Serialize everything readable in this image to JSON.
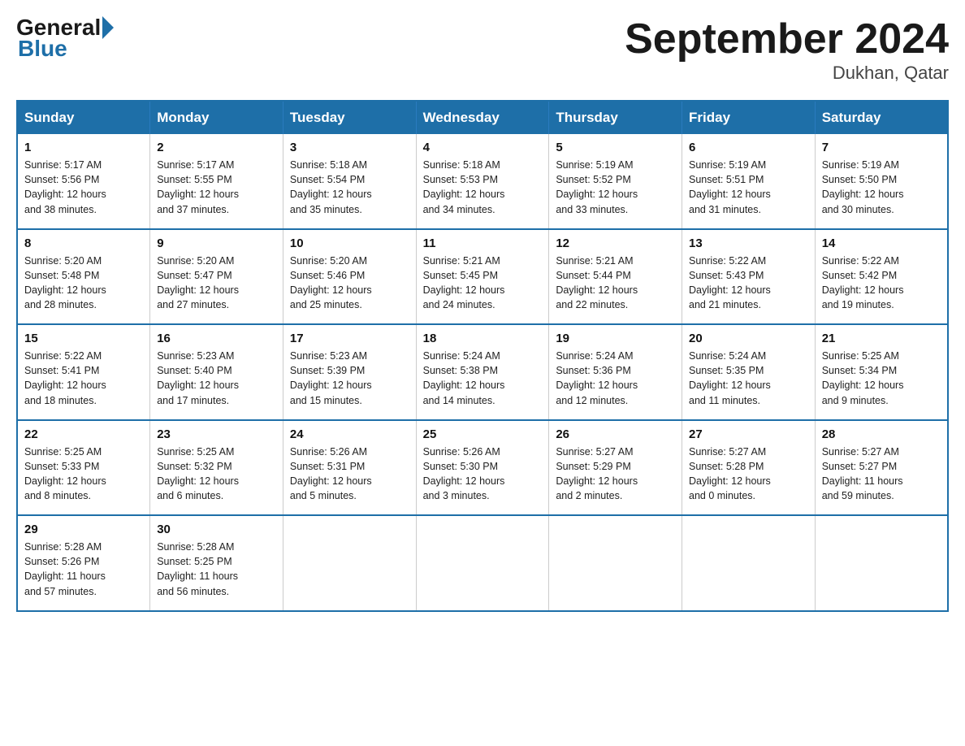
{
  "logo": {
    "general": "General",
    "blue": "Blue"
  },
  "title": "September 2024",
  "subtitle": "Dukhan, Qatar",
  "days_of_week": [
    "Sunday",
    "Monday",
    "Tuesday",
    "Wednesday",
    "Thursday",
    "Friday",
    "Saturday"
  ],
  "weeks": [
    [
      {
        "day": "1",
        "sunrise": "5:17 AM",
        "sunset": "5:56 PM",
        "daylight": "12 hours and 38 minutes."
      },
      {
        "day": "2",
        "sunrise": "5:17 AM",
        "sunset": "5:55 PM",
        "daylight": "12 hours and 37 minutes."
      },
      {
        "day": "3",
        "sunrise": "5:18 AM",
        "sunset": "5:54 PM",
        "daylight": "12 hours and 35 minutes."
      },
      {
        "day": "4",
        "sunrise": "5:18 AM",
        "sunset": "5:53 PM",
        "daylight": "12 hours and 34 minutes."
      },
      {
        "day": "5",
        "sunrise": "5:19 AM",
        "sunset": "5:52 PM",
        "daylight": "12 hours and 33 minutes."
      },
      {
        "day": "6",
        "sunrise": "5:19 AM",
        "sunset": "5:51 PM",
        "daylight": "12 hours and 31 minutes."
      },
      {
        "day": "7",
        "sunrise": "5:19 AM",
        "sunset": "5:50 PM",
        "daylight": "12 hours and 30 minutes."
      }
    ],
    [
      {
        "day": "8",
        "sunrise": "5:20 AM",
        "sunset": "5:48 PM",
        "daylight": "12 hours and 28 minutes."
      },
      {
        "day": "9",
        "sunrise": "5:20 AM",
        "sunset": "5:47 PM",
        "daylight": "12 hours and 27 minutes."
      },
      {
        "day": "10",
        "sunrise": "5:20 AM",
        "sunset": "5:46 PM",
        "daylight": "12 hours and 25 minutes."
      },
      {
        "day": "11",
        "sunrise": "5:21 AM",
        "sunset": "5:45 PM",
        "daylight": "12 hours and 24 minutes."
      },
      {
        "day": "12",
        "sunrise": "5:21 AM",
        "sunset": "5:44 PM",
        "daylight": "12 hours and 22 minutes."
      },
      {
        "day": "13",
        "sunrise": "5:22 AM",
        "sunset": "5:43 PM",
        "daylight": "12 hours and 21 minutes."
      },
      {
        "day": "14",
        "sunrise": "5:22 AM",
        "sunset": "5:42 PM",
        "daylight": "12 hours and 19 minutes."
      }
    ],
    [
      {
        "day": "15",
        "sunrise": "5:22 AM",
        "sunset": "5:41 PM",
        "daylight": "12 hours and 18 minutes."
      },
      {
        "day": "16",
        "sunrise": "5:23 AM",
        "sunset": "5:40 PM",
        "daylight": "12 hours and 17 minutes."
      },
      {
        "day": "17",
        "sunrise": "5:23 AM",
        "sunset": "5:39 PM",
        "daylight": "12 hours and 15 minutes."
      },
      {
        "day": "18",
        "sunrise": "5:24 AM",
        "sunset": "5:38 PM",
        "daylight": "12 hours and 14 minutes."
      },
      {
        "day": "19",
        "sunrise": "5:24 AM",
        "sunset": "5:36 PM",
        "daylight": "12 hours and 12 minutes."
      },
      {
        "day": "20",
        "sunrise": "5:24 AM",
        "sunset": "5:35 PM",
        "daylight": "12 hours and 11 minutes."
      },
      {
        "day": "21",
        "sunrise": "5:25 AM",
        "sunset": "5:34 PM",
        "daylight": "12 hours and 9 minutes."
      }
    ],
    [
      {
        "day": "22",
        "sunrise": "5:25 AM",
        "sunset": "5:33 PM",
        "daylight": "12 hours and 8 minutes."
      },
      {
        "day": "23",
        "sunrise": "5:25 AM",
        "sunset": "5:32 PM",
        "daylight": "12 hours and 6 minutes."
      },
      {
        "day": "24",
        "sunrise": "5:26 AM",
        "sunset": "5:31 PM",
        "daylight": "12 hours and 5 minutes."
      },
      {
        "day": "25",
        "sunrise": "5:26 AM",
        "sunset": "5:30 PM",
        "daylight": "12 hours and 3 minutes."
      },
      {
        "day": "26",
        "sunrise": "5:27 AM",
        "sunset": "5:29 PM",
        "daylight": "12 hours and 2 minutes."
      },
      {
        "day": "27",
        "sunrise": "5:27 AM",
        "sunset": "5:28 PM",
        "daylight": "12 hours and 0 minutes."
      },
      {
        "day": "28",
        "sunrise": "5:27 AM",
        "sunset": "5:27 PM",
        "daylight": "11 hours and 59 minutes."
      }
    ],
    [
      {
        "day": "29",
        "sunrise": "5:28 AM",
        "sunset": "5:26 PM",
        "daylight": "11 hours and 57 minutes."
      },
      {
        "day": "30",
        "sunrise": "5:28 AM",
        "sunset": "5:25 PM",
        "daylight": "11 hours and 56 minutes."
      },
      null,
      null,
      null,
      null,
      null
    ]
  ],
  "labels": {
    "sunrise": "Sunrise:",
    "sunset": "Sunset:",
    "daylight": "Daylight:"
  }
}
